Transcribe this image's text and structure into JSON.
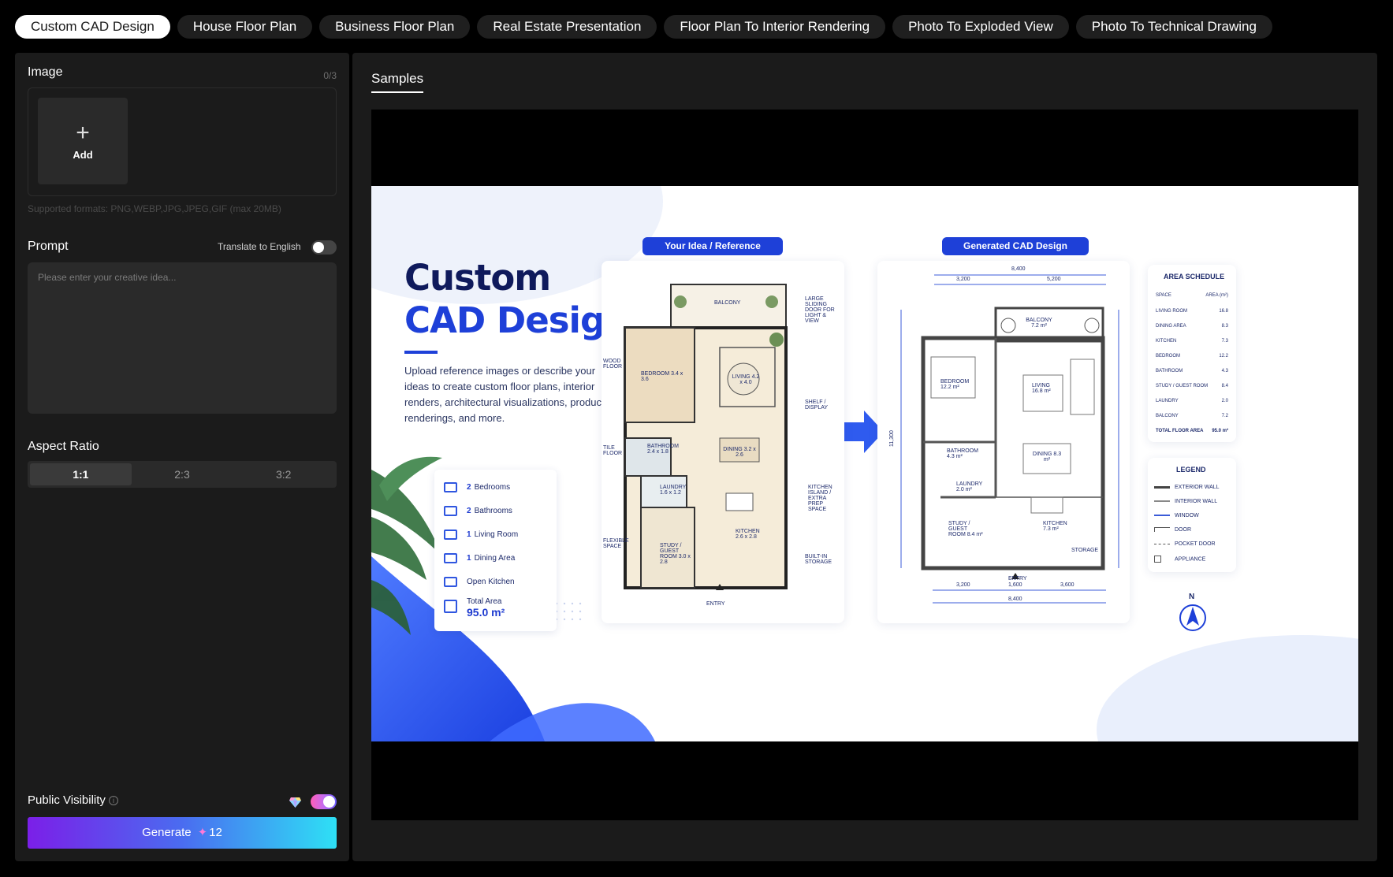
{
  "tabs": [
    {
      "label": "Custom CAD Design",
      "active": true
    },
    {
      "label": "House Floor Plan",
      "active": false
    },
    {
      "label": "Business Floor Plan",
      "active": false
    },
    {
      "label": "Real Estate Presentation",
      "active": false
    },
    {
      "label": "Floor Plan To Interior Rendering",
      "active": false
    },
    {
      "label": "Photo To Exploded View",
      "active": false
    },
    {
      "label": "Photo To Technical Drawing",
      "active": false
    }
  ],
  "left": {
    "image_label": "Image",
    "image_count": "0/3",
    "add_label": "Add",
    "formats": "Supported formats: PNG,WEBP,JPG,JPEG,GIF (max 20MB)",
    "prompt_label": "Prompt",
    "translate_label": "Translate to English",
    "translate_on": false,
    "prompt_placeholder": "Please enter your creative idea...",
    "prompt_value": "",
    "aspect_label": "Aspect Ratio",
    "ratios": [
      "1:1",
      "2:3",
      "3:2"
    ],
    "selected_ratio": "1:1",
    "visibility_label": "Public Visibility",
    "visibility_on": true,
    "generate_label": "Generate",
    "generate_cost": "12"
  },
  "right": {
    "samples_label": "Samples",
    "sample": {
      "title_line1": "Custom",
      "title_line2": "CAD Design",
      "description": "Upload reference images or describe your ideas to create custom floor plans, interior renders, architectural visualizations, product renderings, and more.",
      "reference_pill": "Your Idea / Reference",
      "generated_pill": "Generated CAD Design",
      "stats": [
        {
          "value": "2",
          "label": "Bedrooms"
        },
        {
          "value": "2",
          "label": "Bathrooms"
        },
        {
          "value": "1",
          "label": "Living Room"
        },
        {
          "value": "1",
          "label": "Dining Area"
        },
        {
          "value": "",
          "label": "Open Kitchen"
        },
        {
          "value": "95.0 m²",
          "label": "Total Area"
        }
      ],
      "sketch_labels": {
        "balcony": "BALCONY",
        "bedroom": "BEDROOM 3.4 x 3.6",
        "living": "LIVING 4.2 x 4.0",
        "dining": "DINING 3.2 x 2.6",
        "bathroom": "BATHROOM 2.4 x 1.8",
        "laundry": "LAUNDRY 1.6 x 1.2",
        "kitchen": "KITCHEN 2.6 x 2.8",
        "study": "STUDY / GUEST ROOM 3.0 x 2.8",
        "entry": "ENTRY",
        "note_door": "LARGE SLIDING DOOR FOR LIGHT & VIEW",
        "note_shelf": "SHELF / DISPLAY",
        "note_island": "KITCHEN ISLAND / EXTRA PREP SPACE",
        "note_storage": "BUILT-IN STORAGE",
        "note_wood": "WOOD FLOOR",
        "note_tile": "TILE FLOOR",
        "note_flex": "FLEXIBLE SPACE"
      },
      "cad_labels": {
        "dim_top": "8,400",
        "dim_top_left": "3,200",
        "dim_top_right": "5,200",
        "dim_bottom": "8,400",
        "dim_bottom_left": "3,200",
        "dim_bottom_mid": "1,600",
        "dim_bottom_right": "3,600",
        "dim_side": "11,300",
        "balcony": "BALCONY 7.2 m²",
        "bedroom": "BEDROOM 12.2 m²",
        "living": "LIVING 16.8 m²",
        "bathroom": "BATHROOM 4.3 m²",
        "dining": "DINING 8.3 m²",
        "laundry": "LAUNDRY 2.0 m²",
        "kitchen": "KITCHEN 7.3 m²",
        "study": "STUDY / GUEST ROOM 8.4 m²",
        "storage": "STORAGE",
        "entry": "ENTRY"
      },
      "area_schedule": {
        "title": "AREA SCHEDULE",
        "header": [
          "SPACE",
          "AREA (m²)"
        ],
        "rows": [
          [
            "LIVING ROOM",
            "16.8"
          ],
          [
            "DINING AREA",
            "8.3"
          ],
          [
            "KITCHEN",
            "7.3"
          ],
          [
            "BEDROOM",
            "12.2"
          ],
          [
            "BATHROOM",
            "4.3"
          ],
          [
            "STUDY / GUEST ROOM",
            "8.4"
          ],
          [
            "LAUNDRY",
            "2.0"
          ],
          [
            "BALCONY",
            "7.2"
          ]
        ],
        "total_label": "TOTAL FLOOR AREA",
        "total_value": "95.0 m²"
      },
      "legend": {
        "title": "LEGEND",
        "items": [
          "EXTERIOR WALL",
          "INTERIOR WALL",
          "WINDOW",
          "DOOR",
          "POCKET DOOR",
          "APPLIANCE"
        ]
      },
      "north": "N"
    }
  },
  "colors": {
    "accent_blue": "#1e40d8",
    "navy": "#0f1a5c",
    "panel_bg": "#1b1b1b"
  }
}
